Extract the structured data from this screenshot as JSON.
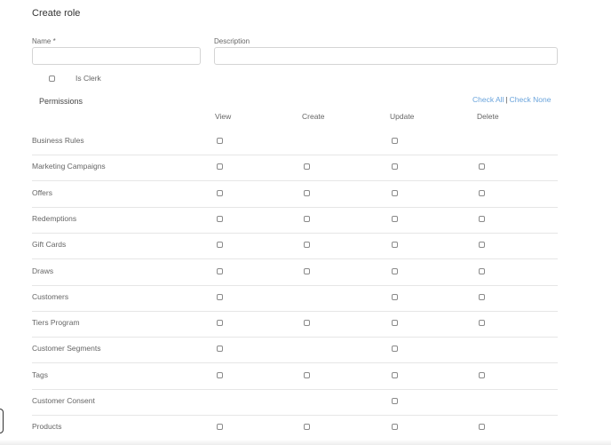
{
  "page": {
    "title": "Create role"
  },
  "form": {
    "name_label": "Name *",
    "name_value": "",
    "description_label": "Description",
    "description_value": "",
    "is_clerk_label": "Is Clerk",
    "is_clerk_checked": false
  },
  "permissions": {
    "title": "Permissions",
    "check_all": "Check All",
    "separator": "|",
    "check_none": "Check None",
    "columns": [
      "View",
      "Create",
      "Update",
      "Delete"
    ],
    "rows": [
      {
        "label": "Business Rules",
        "view": true,
        "create": false,
        "update": true,
        "delete": false
      },
      {
        "label": "Marketing Campaigns",
        "view": true,
        "create": true,
        "update": true,
        "delete": true
      },
      {
        "label": "Offers",
        "view": true,
        "create": true,
        "update": true,
        "delete": true
      },
      {
        "label": "Redemptions",
        "view": true,
        "create": true,
        "update": true,
        "delete": true
      },
      {
        "label": "Gift Cards",
        "view": true,
        "create": true,
        "update": true,
        "delete": true
      },
      {
        "label": "Draws",
        "view": true,
        "create": true,
        "update": true,
        "delete": true
      },
      {
        "label": "Customers",
        "view": true,
        "create": false,
        "update": true,
        "delete": true
      },
      {
        "label": "Tiers Program",
        "view": true,
        "create": true,
        "update": true,
        "delete": true
      },
      {
        "label": "Customer Segments",
        "view": true,
        "create": false,
        "update": true,
        "delete": false
      },
      {
        "label": "Tags",
        "view": true,
        "create": true,
        "update": true,
        "delete": true
      },
      {
        "label": "Customer Consent",
        "view": false,
        "create": false,
        "update": true,
        "delete": false
      },
      {
        "label": "Products",
        "view": true,
        "create": true,
        "update": true,
        "delete": true
      }
    ]
  }
}
